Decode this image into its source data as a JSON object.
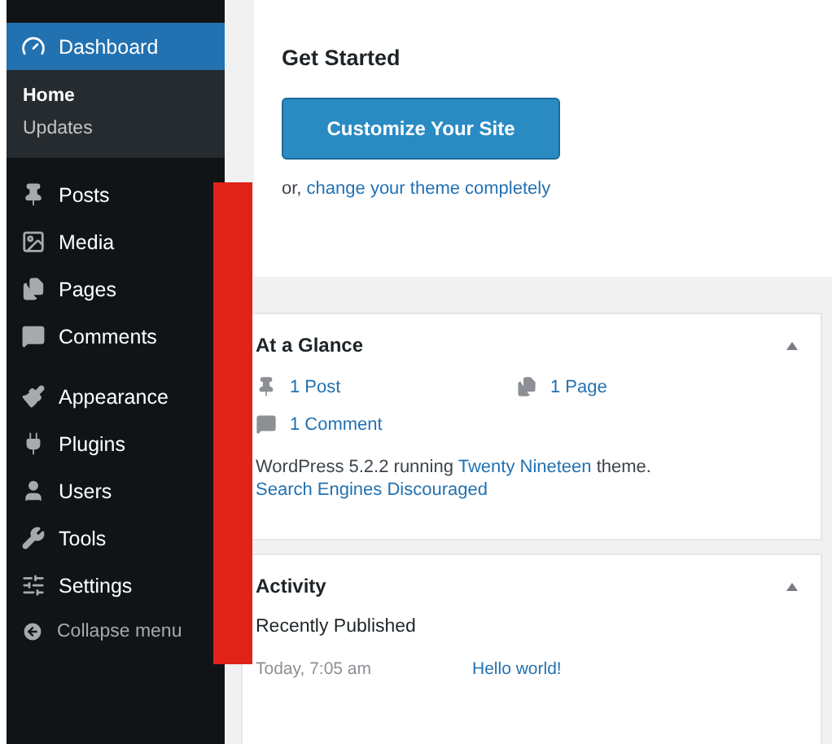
{
  "sidebar": {
    "groups": [
      {
        "items": [
          {
            "label": "Dashboard",
            "selected": true,
            "children": [
              {
                "label": "Home",
                "selected": true
              },
              {
                "label": "Updates",
                "selected": false
              }
            ]
          }
        ]
      },
      {
        "items": [
          {
            "label": "Posts",
            "selected": false
          },
          {
            "label": "Media",
            "selected": false
          },
          {
            "label": "Pages",
            "selected": false
          },
          {
            "label": "Comments",
            "selected": false
          }
        ]
      },
      {
        "items": [
          {
            "label": "Appearance",
            "selected": false
          },
          {
            "label": "Plugins",
            "selected": false
          },
          {
            "label": "Users",
            "selected": false
          },
          {
            "label": "Tools",
            "selected": false
          },
          {
            "label": "Settings",
            "selected": false
          }
        ]
      }
    ],
    "collapse": {
      "label": "Collapse menu"
    }
  },
  "get_started": {
    "title": "Get Started",
    "button": "Customize Your Site",
    "prefix": "or,",
    "link": "change your theme completely"
  },
  "at_a_glance": {
    "title": "At a Glance",
    "expanded": true,
    "items": [
      {
        "kind": "post",
        "label": "1 Post"
      },
      {
        "kind": "page",
        "label": "1 Page"
      },
      {
        "kind": "comment",
        "label": "1 Comment"
      }
    ],
    "version": {
      "before": "WordPress 5.2.2 running ",
      "link": "Twenty Nineteen",
      "after": " theme."
    },
    "notice": "Search Engines Discouraged"
  },
  "activity": {
    "title": "Activity",
    "expanded": true,
    "subheading": "Recently Published",
    "rows": [
      {
        "date": "Today, 7:05 am",
        "title": "Hello world!"
      }
    ]
  }
}
